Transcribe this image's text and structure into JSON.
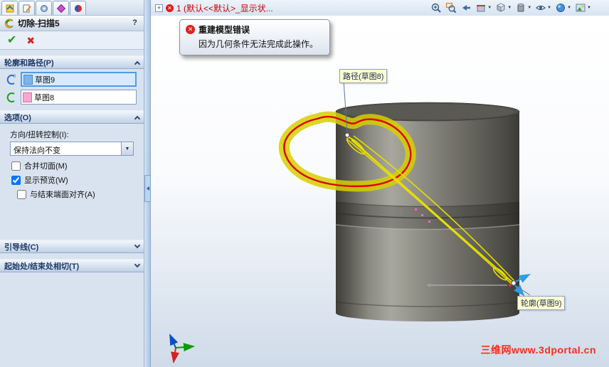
{
  "icons": {
    "check": "✔",
    "cancel": "✖",
    "help": "?",
    "dropdown_arrow": "▼",
    "expand_plus": "+",
    "error_x": "✕"
  },
  "panel": {
    "title": "切除-扫描5",
    "profile_path_group": {
      "label": "轮廓和路径(P)",
      "profile_value": "草图9",
      "path_value": "草图8"
    },
    "options_group": {
      "label": "选项(O)",
      "orientation_label": "方向/扭转控制(I):",
      "orientation_value": "保持法向不变",
      "checkboxes": [
        {
          "label": "合并切面(M)",
          "checked": false
        },
        {
          "label": "显示预览(W)",
          "checked": true
        },
        {
          "label": "与结束端面对齐(A)",
          "checked": false
        }
      ]
    },
    "guide_group": {
      "label": "引导线(C)"
    },
    "tangency_group": {
      "label": "起始处/结束处相切(T)"
    }
  },
  "toolbar": {
    "config_text": "1 (默认<<默认>_显示状..."
  },
  "error_balloon": {
    "title": "重建模型错误",
    "message": "因为几何条件无法完成此操作。"
  },
  "viewport": {
    "path_callout": "路径(草图8)",
    "profile_callout": "轮廓(草图9)",
    "watermark": "三维网www.3dportal.cn"
  },
  "colors": {
    "selection_blue": "#4f9be8",
    "error_red": "#e01818",
    "preview_yellow": "#e2da00",
    "profile_red": "#e00000",
    "model_gray": "#7c7b73",
    "watermark_red": "#ff2b1a"
  }
}
